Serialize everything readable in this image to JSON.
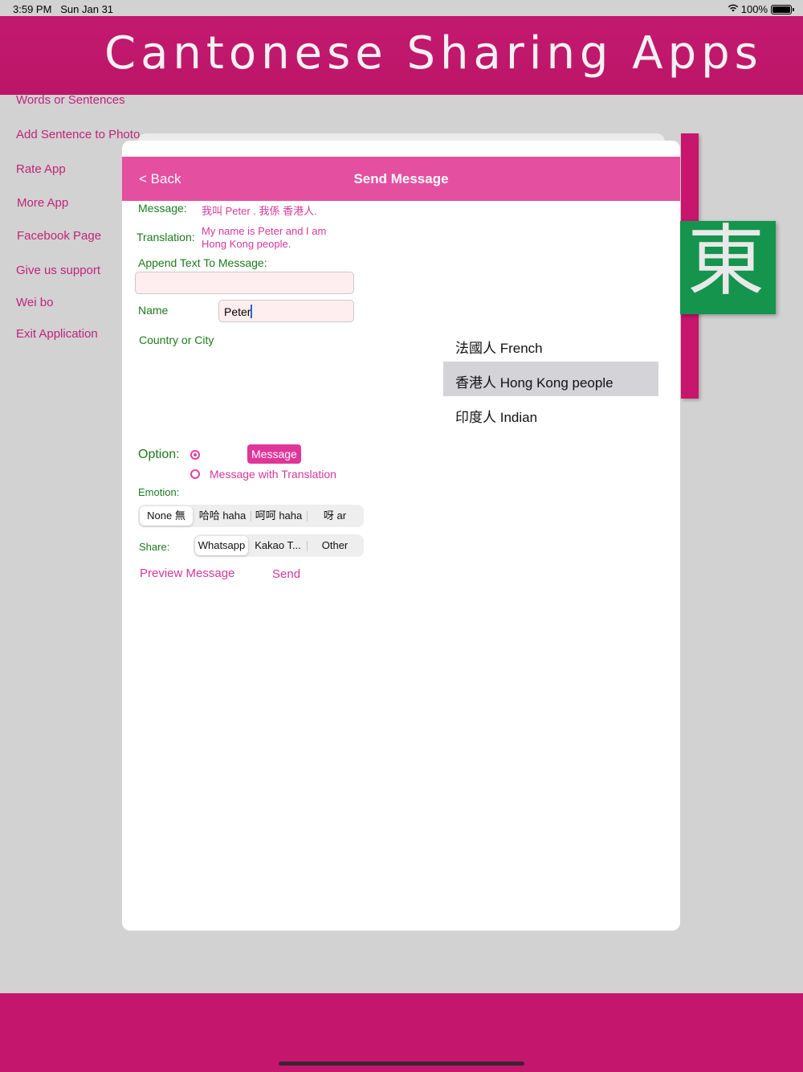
{
  "status": {
    "time": "3:59 PM",
    "date": "Sun Jan 31",
    "battery": "100%"
  },
  "banner": {
    "title": "Cantonese Sharing Apps"
  },
  "bg_tile": {
    "char": "東"
  },
  "menu": [
    "Words or Sentences",
    "Add Sentence to Photo",
    "Rate App",
    "More App",
    "Facebook Page",
    "Give us support",
    "Wei bo",
    "Exit Application"
  ],
  "nav": {
    "back": "< Back",
    "title": "Send Message"
  },
  "form": {
    "message_label": "Message:",
    "message_value": "我叫  Peter . 我係 香港人.",
    "translation_label": "Translation:",
    "translation_line1": "My name is Peter and I am",
    "translation_line2": "Hong Kong people.",
    "append_label": "Append Text To Message:",
    "append_value": "",
    "name_label": "Name",
    "name_value": "Peter",
    "country_label": "Country or City"
  },
  "picker": [
    {
      "label": "法國人 French",
      "selected": false
    },
    {
      "label": "香港人 Hong Kong people",
      "selected": true
    },
    {
      "label": "印度人 Indian",
      "selected": false
    }
  ],
  "option": {
    "label": "Option:",
    "choice1": "Message",
    "choice2": "Message with Translation",
    "selected": "Message"
  },
  "emotion": {
    "label": "Emotion:",
    "segments": [
      "None 無",
      "哈哈 haha",
      "呵呵 haha",
      "呀 ar"
    ],
    "selected": "None 無"
  },
  "share": {
    "label": "Share:",
    "segments": [
      "Whatsapp",
      "Kakao T...",
      "Other"
    ],
    "selected": "Whatsapp"
  },
  "actions": {
    "preview": "Preview Message",
    "send": "Send"
  },
  "colors": {
    "brand": "#c3196f",
    "nav": "#e54fa0",
    "accent": "#d5389a",
    "label_green": "#1b7b1b"
  }
}
